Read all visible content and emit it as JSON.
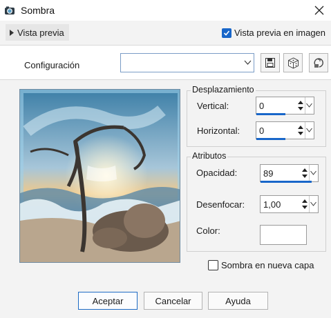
{
  "window": {
    "title": "Sombra"
  },
  "preview_toggle_label": "Vista previa",
  "preview_checkbox": {
    "label": "Vista previa en imagen",
    "checked": true
  },
  "config": {
    "label": "Configuración",
    "value": ""
  },
  "displacement": {
    "title": "Desplazamiento",
    "vertical": {
      "label": "Vertical:",
      "value": "0"
    },
    "horizontal": {
      "label": "Horizontal:",
      "value": "0"
    }
  },
  "attributes": {
    "title": "Atributos",
    "opacity": {
      "label": "Opacidad:",
      "value": "89"
    },
    "blur": {
      "label": "Desenfocar:",
      "value": "1,00"
    },
    "color": {
      "label": "Color:",
      "value": "#ffffff"
    }
  },
  "new_layer_checkbox": {
    "label": "Sombra en nueva capa",
    "checked": false
  },
  "buttons": {
    "accept": "Aceptar",
    "cancel": "Cancelar",
    "help": "Ayuda"
  },
  "colors": {
    "accent": "#1866c9"
  }
}
